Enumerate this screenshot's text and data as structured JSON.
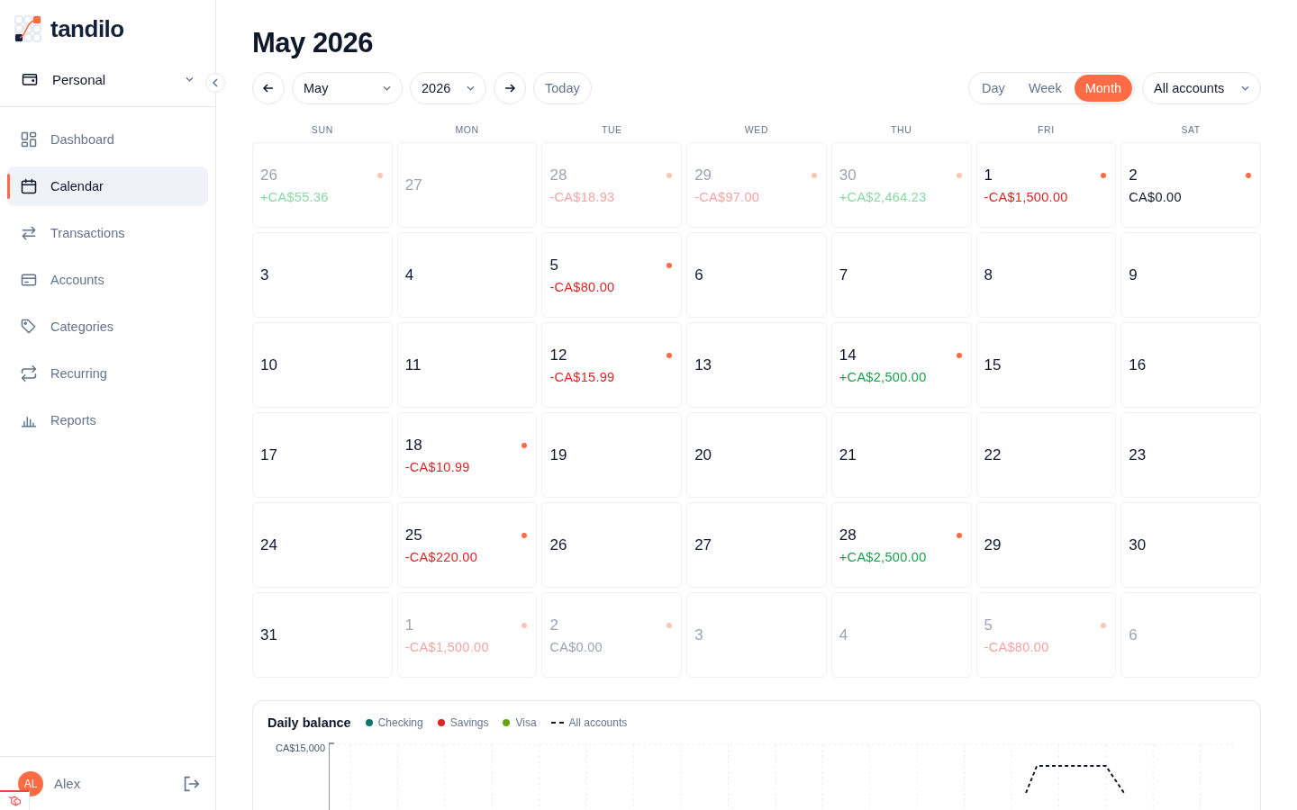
{
  "brand": {
    "name": "tandilo"
  },
  "workspace": {
    "label": "Personal"
  },
  "nav": [
    {
      "label": "Dashboard",
      "selected": false
    },
    {
      "label": "Calendar",
      "selected": true
    },
    {
      "label": "Transactions",
      "selected": false
    },
    {
      "label": "Accounts",
      "selected": false
    },
    {
      "label": "Categories",
      "selected": false
    },
    {
      "label": "Recurring",
      "selected": false
    },
    {
      "label": "Reports",
      "selected": false
    }
  ],
  "user": {
    "name": "Alex",
    "initials": "AL"
  },
  "title": "May 2026",
  "month_select": {
    "value": "May"
  },
  "year_select": {
    "value": "2026"
  },
  "today_button": "Today",
  "views": [
    {
      "label": "Day",
      "selected": false
    },
    {
      "label": "Week",
      "selected": false
    },
    {
      "label": "Month",
      "selected": true
    }
  ],
  "account_select": {
    "value": "All accounts"
  },
  "weekdays": [
    "SUN",
    "MON",
    "TUE",
    "WED",
    "THU",
    "FRI",
    "SAT"
  ],
  "days": [
    {
      "day": "26",
      "outside": true,
      "amount": "+CA$55.36",
      "kind": "income"
    },
    {
      "day": "27",
      "outside": true
    },
    {
      "day": "28",
      "outside": true,
      "amount": "-CA$18.93",
      "kind": "expense"
    },
    {
      "day": "29",
      "outside": true,
      "amount": "-CA$97.00",
      "kind": "expense"
    },
    {
      "day": "30",
      "outside": true,
      "amount": "+CA$2,464.23",
      "kind": "income"
    },
    {
      "day": "1",
      "outside": false,
      "amount": "-CA$1,500.00",
      "kind": "expense"
    },
    {
      "day": "2",
      "outside": false,
      "amount": "CA$0.00",
      "kind": "zero"
    },
    {
      "day": "3",
      "outside": false
    },
    {
      "day": "4",
      "outside": false
    },
    {
      "day": "5",
      "outside": false,
      "amount": "-CA$80.00",
      "kind": "expense"
    },
    {
      "day": "6",
      "outside": false
    },
    {
      "day": "7",
      "outside": false
    },
    {
      "day": "8",
      "outside": false
    },
    {
      "day": "9",
      "outside": false
    },
    {
      "day": "10",
      "outside": false
    },
    {
      "day": "11",
      "outside": false
    },
    {
      "day": "12",
      "outside": false,
      "amount": "-CA$15.99",
      "kind": "expense"
    },
    {
      "day": "13",
      "outside": false
    },
    {
      "day": "14",
      "outside": false,
      "amount": "+CA$2,500.00",
      "kind": "income"
    },
    {
      "day": "15",
      "outside": false
    },
    {
      "day": "16",
      "outside": false
    },
    {
      "day": "17",
      "outside": false
    },
    {
      "day": "18",
      "outside": false,
      "amount": "-CA$10.99",
      "kind": "expense"
    },
    {
      "day": "19",
      "outside": false
    },
    {
      "day": "20",
      "outside": false
    },
    {
      "day": "21",
      "outside": false
    },
    {
      "day": "22",
      "outside": false
    },
    {
      "day": "23",
      "outside": false
    },
    {
      "day": "24",
      "outside": false
    },
    {
      "day": "25",
      "outside": false,
      "amount": "-CA$220.00",
      "kind": "expense"
    },
    {
      "day": "26",
      "outside": false
    },
    {
      "day": "27",
      "outside": false
    },
    {
      "day": "28",
      "outside": false,
      "amount": "+CA$2,500.00",
      "kind": "income"
    },
    {
      "day": "29",
      "outside": false
    },
    {
      "day": "30",
      "outside": false
    },
    {
      "day": "31",
      "outside": false
    },
    {
      "day": "1",
      "outside": true,
      "amount": "-CA$1,500.00",
      "kind": "expense"
    },
    {
      "day": "2",
      "outside": true,
      "amount": "CA$0.00",
      "kind": "zero"
    },
    {
      "day": "3",
      "outside": true
    },
    {
      "day": "4",
      "outside": true
    },
    {
      "day": "5",
      "outside": true,
      "amount": "-CA$80.00",
      "kind": "expense"
    },
    {
      "day": "6",
      "outside": true
    }
  ],
  "balance_panel": {
    "title": "Daily balance",
    "legend": [
      {
        "label": "Checking",
        "kind": "dot",
        "color": "#0f766e"
      },
      {
        "label": "Savings",
        "kind": "dot",
        "color": "#dc2626"
      },
      {
        "label": "Visa",
        "kind": "dot",
        "color": "#65a30d"
      },
      {
        "label": "All accounts",
        "kind": "dash",
        "color": "#111827"
      }
    ],
    "y_tick": "CA$15,000"
  }
}
